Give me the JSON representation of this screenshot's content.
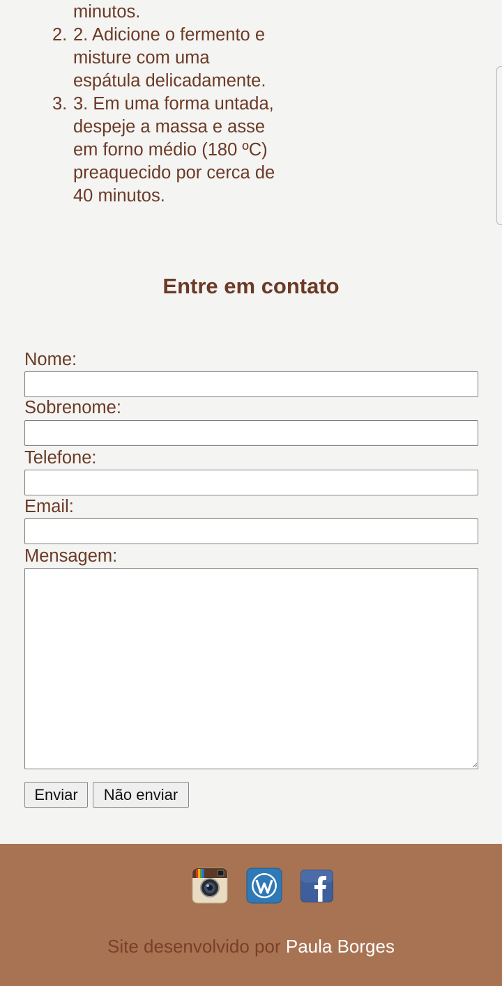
{
  "steps": {
    "prev_tail": "minutos.",
    "items": [
      {
        "marker": "2.",
        "lines": [
          "2. Adicione o fermento e",
          "misture com uma",
          "espátula delicadamente."
        ]
      },
      {
        "marker": "3.",
        "lines": [
          "3. Em uma forma untada,",
          "despeje a massa e asse",
          "em forno médio (180 ºC)",
          "preaquecido por cerca de",
          "40 minutos."
        ]
      }
    ]
  },
  "contact": {
    "title": "Entre em contato",
    "fields": {
      "nome": {
        "label": "Nome:",
        "value": ""
      },
      "sobrenome": {
        "label": "Sobrenome:",
        "value": ""
      },
      "telefone": {
        "label": "Telefone:",
        "value": ""
      },
      "email": {
        "label": "Email:",
        "value": ""
      },
      "mensagem": {
        "label": "Mensagem:",
        "value": ""
      }
    },
    "buttons": {
      "send": "Enviar",
      "cancel": "Não enviar"
    }
  },
  "footer": {
    "social_icons": [
      "instagram-icon",
      "wordpress-icon",
      "facebook-icon"
    ],
    "credit_prefix": "Site desenvolvido por",
    "credit_author": "Paula Borges"
  },
  "colors": {
    "text_brown": "#6b3a26",
    "page_bg": "#f4f4f2",
    "footer_bg": "#a87353",
    "credit_prefix": "#7a3f27",
    "credit_author": "#ffffff"
  }
}
